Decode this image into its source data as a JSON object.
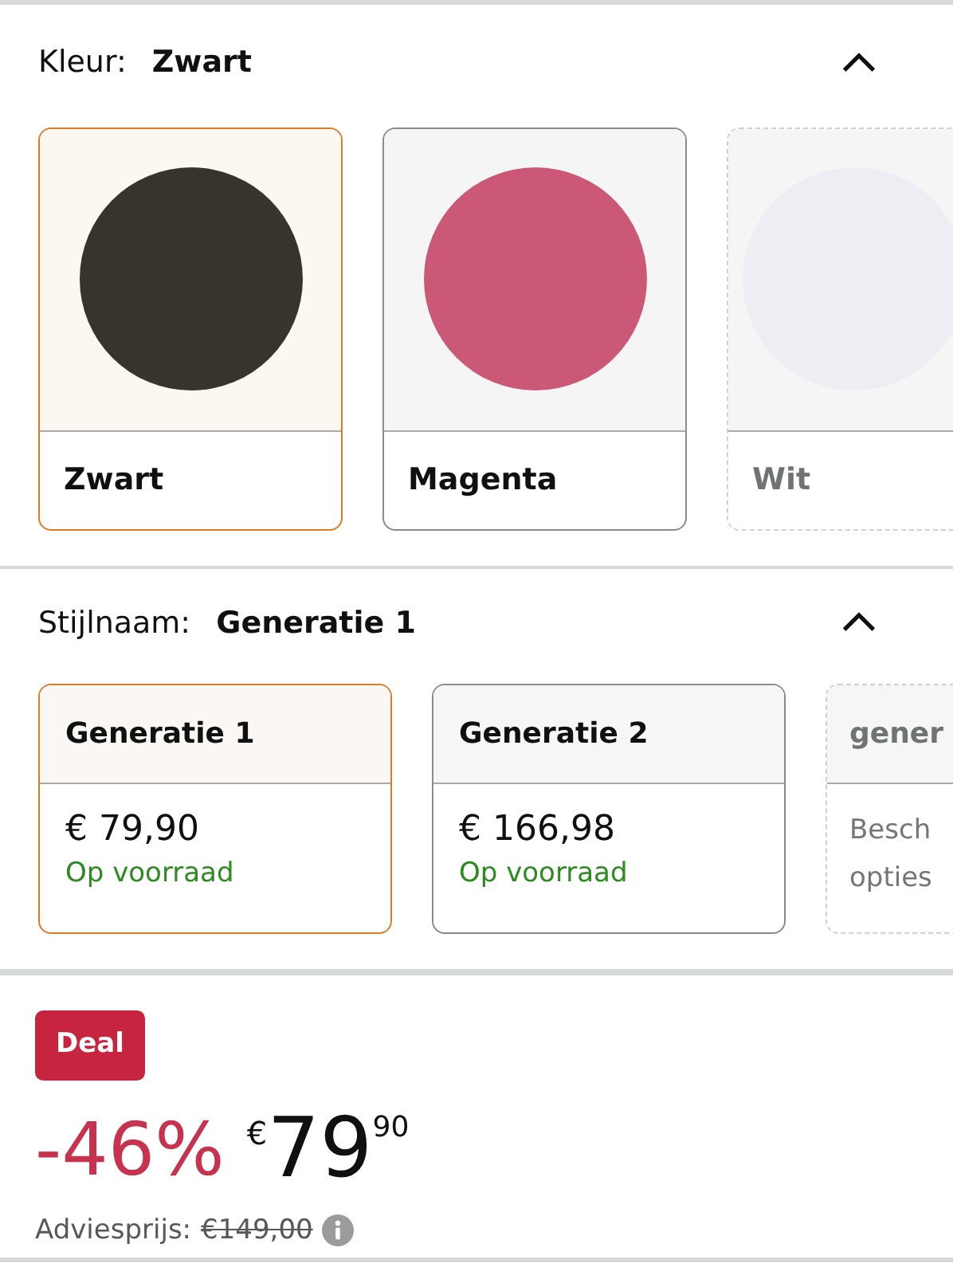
{
  "color_section": {
    "label": "Kleur:",
    "value": "Zwart",
    "expanded": true,
    "options": [
      {
        "name": "Zwart",
        "color": "#38332c",
        "selected": true,
        "available": true
      },
      {
        "name": "Magenta",
        "color": "#cc5877",
        "selected": false,
        "available": true
      },
      {
        "name": "Wit",
        "color": "#eceef4",
        "selected": false,
        "available": false
      }
    ]
  },
  "style_section": {
    "label": "Stijlnaam:",
    "value": "Generatie 1",
    "expanded": true,
    "options": [
      {
        "name": "Generatie 1",
        "price": "€ 79,90",
        "stock": "Op voorraad",
        "selected": true,
        "available": true
      },
      {
        "name": "Generatie 2",
        "price": "€ 166,98",
        "stock": "Op voorraad",
        "selected": false,
        "available": true
      },
      {
        "name": "gener",
        "lines": [
          "Besch",
          "opties"
        ],
        "selected": false,
        "available": false
      }
    ]
  },
  "price": {
    "badge": "Deal",
    "discount": "-46%",
    "currency": "€",
    "whole": "79",
    "fraction": "90",
    "list_label": "Adviesprijs:",
    "list_price": "€149,00"
  }
}
